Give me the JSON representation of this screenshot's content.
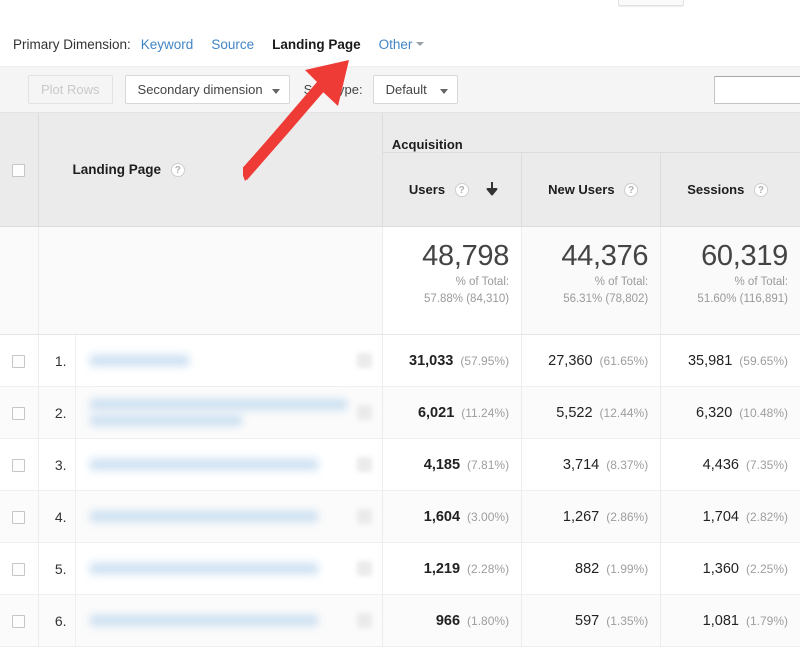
{
  "primary_dimension": {
    "label": "Primary Dimension:",
    "links": [
      {
        "text": "Keyword",
        "active": false,
        "dropdown": false
      },
      {
        "text": "Source",
        "active": false,
        "dropdown": false
      },
      {
        "text": "Landing Page",
        "active": true,
        "dropdown": false
      },
      {
        "text": "Other",
        "active": false,
        "dropdown": true
      }
    ]
  },
  "toolbar": {
    "plot_rows_label": "Plot Rows",
    "secondary_dimension_label": "Secondary dimension",
    "sort_type_label": "Sort Type:",
    "sort_type_value": "Default",
    "search_value": "",
    "search_placeholder": ""
  },
  "table": {
    "dimension_header": "Landing Page",
    "group_header": "Acquisition",
    "help_glyph": "?",
    "metrics": [
      {
        "label": "Users",
        "sorted": true,
        "sort_dir": "desc"
      },
      {
        "label": "New Users",
        "sorted": false,
        "sort_dir": ""
      },
      {
        "label": "Sessions",
        "sorted": false,
        "sort_dir": ""
      }
    ],
    "totals": [
      {
        "value": "48,798",
        "of_total_label": "% of Total:",
        "of_total_value": "57.88% (84,310)"
      },
      {
        "value": "44,376",
        "of_total_label": "% of Total:",
        "of_total_value": "56.31% (78,802)"
      },
      {
        "value": "60,319",
        "of_total_label": "% of Total:",
        "of_total_value": "51.60% (116,891)"
      }
    ],
    "rows": [
      {
        "index": "1.",
        "landing_page_redacted": true,
        "redaction_lines": 1,
        "cells": [
          {
            "value": "31,033",
            "pct": "(57.95%)"
          },
          {
            "value": "27,360",
            "pct": "(61.65%)"
          },
          {
            "value": "35,981",
            "pct": "(59.65%)"
          }
        ]
      },
      {
        "index": "2.",
        "landing_page_redacted": true,
        "redaction_lines": 2,
        "cells": [
          {
            "value": "6,021",
            "pct": "(11.24%)"
          },
          {
            "value": "5,522",
            "pct": "(12.44%)"
          },
          {
            "value": "6,320",
            "pct": "(10.48%)"
          }
        ]
      },
      {
        "index": "3.",
        "landing_page_redacted": true,
        "redaction_lines": 1,
        "cells": [
          {
            "value": "4,185",
            "pct": "(7.81%)"
          },
          {
            "value": "3,714",
            "pct": "(8.37%)"
          },
          {
            "value": "4,436",
            "pct": "(7.35%)"
          }
        ]
      },
      {
        "index": "4.",
        "landing_page_redacted": true,
        "redaction_lines": 1,
        "cells": [
          {
            "value": "1,604",
            "pct": "(3.00%)"
          },
          {
            "value": "1,267",
            "pct": "(2.86%)"
          },
          {
            "value": "1,704",
            "pct": "(2.82%)"
          }
        ]
      },
      {
        "index": "5.",
        "landing_page_redacted": true,
        "redaction_lines": 1,
        "cells": [
          {
            "value": "1,219",
            "pct": "(2.28%)"
          },
          {
            "value": "882",
            "pct": "(1.99%)"
          },
          {
            "value": "1,360",
            "pct": "(2.25%)"
          }
        ]
      },
      {
        "index": "6.",
        "landing_page_redacted": true,
        "redaction_lines": 1,
        "cells": [
          {
            "value": "966",
            "pct": "(1.80%)"
          },
          {
            "value": "597",
            "pct": "(1.35%)"
          },
          {
            "value": "1,081",
            "pct": "(1.79%)"
          }
        ]
      }
    ]
  },
  "annotation": {
    "type": "arrow",
    "color": "#ef3b36",
    "points_to": "Landing Page"
  },
  "colors": {
    "link": "#4285c5",
    "header_bg": "#ebebeb",
    "toolbar_bg": "#f5f5f5",
    "annotation_red": "#ef3b36"
  }
}
